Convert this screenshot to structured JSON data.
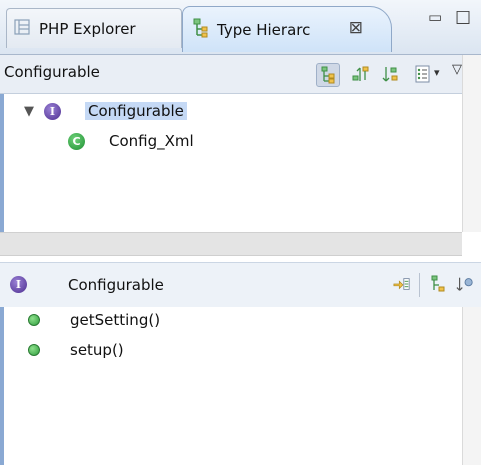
{
  "tabs": [
    {
      "label": "PHP Explorer"
    },
    {
      "label": "Type Hierarc",
      "active": true
    }
  ],
  "hierarchy": {
    "title": "Configurable",
    "tree": [
      {
        "label": "Configurable",
        "kind": "interface",
        "expanded": true,
        "selected": true
      },
      {
        "label": "Config_Xml",
        "kind": "class"
      }
    ]
  },
  "members": {
    "title": "Configurable",
    "items": [
      {
        "label": "getSetting()"
      },
      {
        "label": "setup()"
      }
    ]
  },
  "colors": {
    "selection": "#c5d9f5",
    "interface_icon": "#4b2d8f",
    "class_icon": "#1e8f32",
    "accent_border": "#8aa9d3"
  }
}
